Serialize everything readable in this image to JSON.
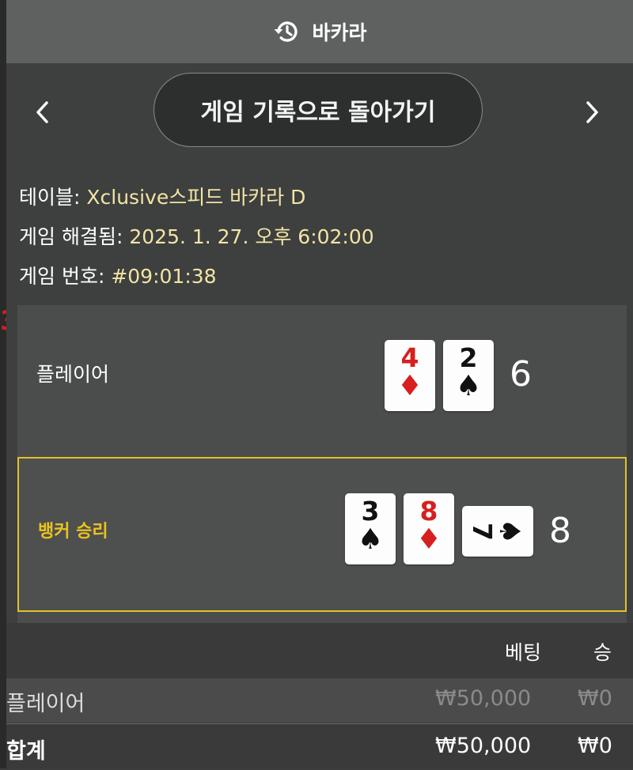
{
  "topbar": {
    "title": "바카라",
    "icon": "history-icon"
  },
  "nav": {
    "prev_icon": "chevron-left-icon",
    "next_icon": "chevron-right-icon",
    "back_label": "게임 기록으로 돌아가기"
  },
  "info": {
    "table_label": "테이블:",
    "table_value": "Xclusive스피드 바카라 D",
    "resolved_label": "게임 해결됨:",
    "resolved_value": "2025. 1. 27. 오후 6:02:00",
    "number_label": "게임 번호:",
    "number_value": "#09:01:38"
  },
  "player": {
    "label": "플레이어",
    "cards": [
      {
        "rank": "4",
        "suit": "♦",
        "color": "red"
      },
      {
        "rank": "2",
        "suit": "♠",
        "color": "black"
      }
    ],
    "score": "6"
  },
  "banker": {
    "label": "뱅커 승리",
    "cards": [
      {
        "rank": "3",
        "suit": "♠",
        "color": "black"
      },
      {
        "rank": "8",
        "suit": "♦",
        "color": "red"
      },
      {
        "rank": "7",
        "suit": "♠",
        "color": "black"
      }
    ],
    "score": "8"
  },
  "bets": {
    "headers": {
      "bet": "베팅",
      "win": "승"
    },
    "rows": [
      {
        "name": "플레이어",
        "bet": "₩50,000",
        "win": "₩0"
      }
    ],
    "total": {
      "name": "합계",
      "bet": "₩50,000",
      "win": "₩0"
    }
  },
  "colors": {
    "accent_gold": "#e3c227",
    "value_text": "#f2e5a4",
    "card_red": "#d71f1f"
  }
}
